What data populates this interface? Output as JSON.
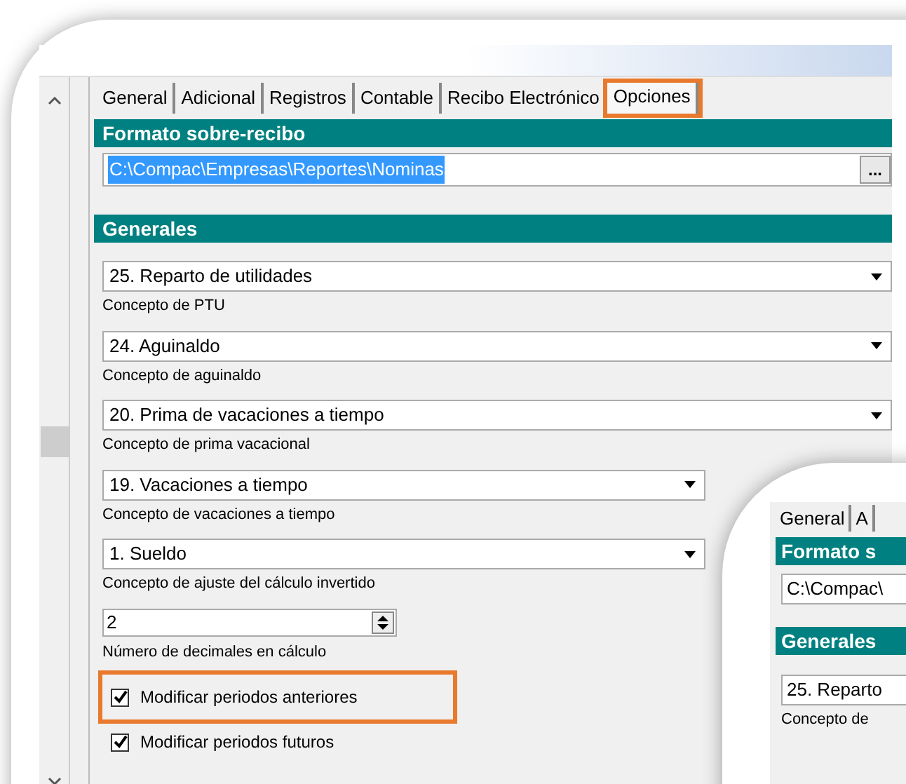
{
  "tabs": [
    {
      "label": "General",
      "selected": false,
      "highlighted": false
    },
    {
      "label": "Adicional",
      "selected": false,
      "highlighted": false
    },
    {
      "label": "Registros",
      "selected": false,
      "highlighted": false
    },
    {
      "label": "Contable",
      "selected": false,
      "highlighted": false
    },
    {
      "label": "Recibo Electrónico",
      "selected": false,
      "highlighted": false
    },
    {
      "label": "Opciones",
      "selected": true,
      "highlighted": true
    }
  ],
  "format_section": {
    "title": "Formato sobre-recibo",
    "path": "C:\\Compac\\Empresas\\Reportes\\Nominas",
    "browse": "..."
  },
  "general_section": {
    "title": "Generales"
  },
  "fields": [
    {
      "kind": "combo",
      "value": "25. Reparto de utilidades",
      "caption": "Concepto de PTU"
    },
    {
      "kind": "combo",
      "value": "24. Aguinaldo",
      "caption": "Concepto de aguinaldo"
    },
    {
      "kind": "combo",
      "value": "20. Prima de vacaciones a tiempo",
      "caption": "Concepto de prima vacacional"
    },
    {
      "kind": "combo",
      "value": "19. Vacaciones a tiempo",
      "caption": "Concepto de vacaciones a tiempo"
    },
    {
      "kind": "combo",
      "value": "1. Sueldo",
      "caption": "Concepto de ajuste del cálculo invertido"
    },
    {
      "kind": "spinner",
      "value": "2",
      "caption": "Número de decimales en cálculo"
    },
    {
      "kind": "checkbox",
      "label": "Modificar periodos anteriores",
      "checked": true,
      "highlighted": true
    },
    {
      "kind": "checkbox",
      "label": "Modificar periodos futuros",
      "checked": true,
      "highlighted": false
    }
  ],
  "inset": {
    "tabs": [
      "General",
      "A"
    ],
    "format_title": "Formato s",
    "path": "C:\\Compac\\",
    "general_title": "Generales",
    "combo": "25. Reparto",
    "caption": "Concepto de"
  }
}
